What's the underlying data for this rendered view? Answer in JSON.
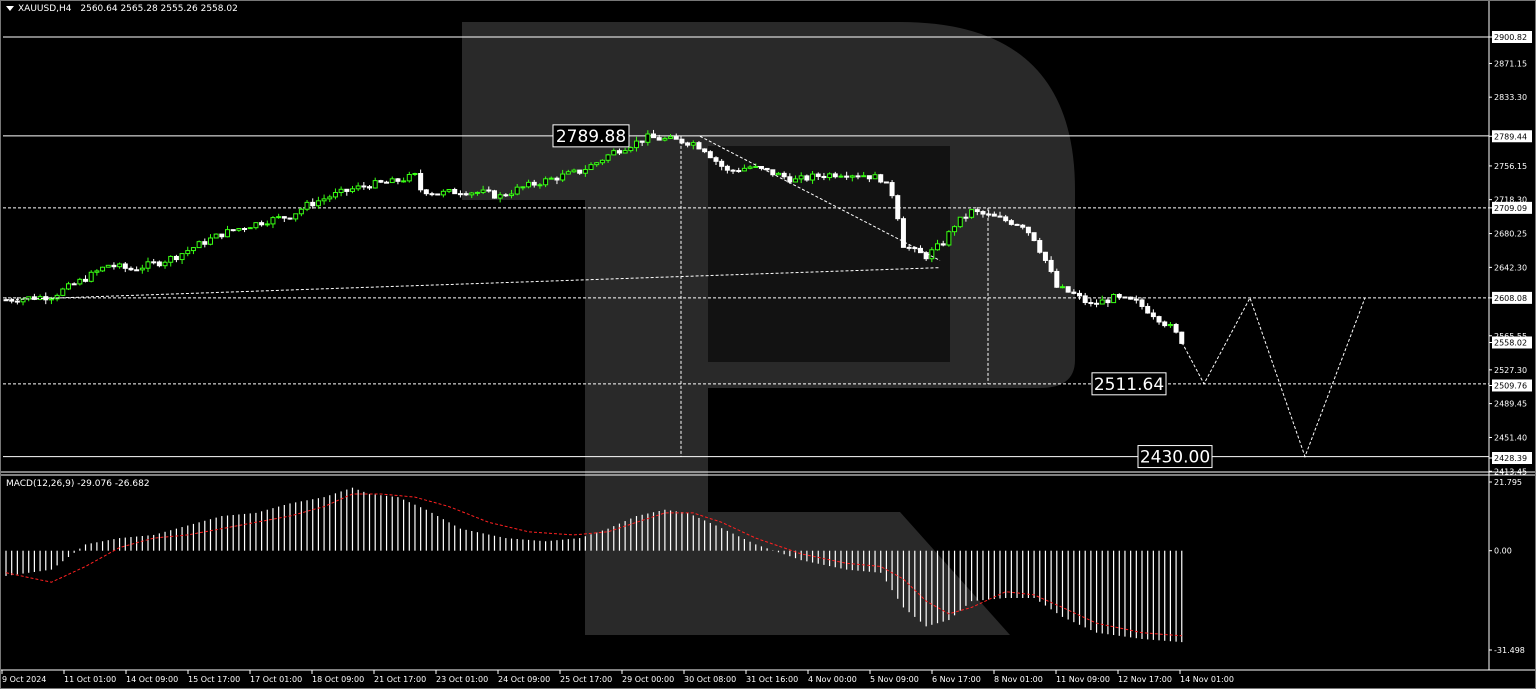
{
  "header": {
    "symbol": "XAUUSD,H4",
    "ohlc": "2560.64 2565.28 2555.26 2558.02"
  },
  "macd_header": "MACD(12,26,9) -29.076 -26.682",
  "colors": {
    "background": "#000000",
    "bull_candle": "#39ff14",
    "bear_candle": "#ffffff",
    "macd_hist": "#ffffff",
    "macd_signal": "#ff2020",
    "watermark": "#4a4a4a",
    "level_line": "#ffffff"
  },
  "chart_data": {
    "type": "candlestick",
    "price_axis": {
      "range": [
        2413.45,
        2920.0
      ],
      "ticks": [
        "2900.82",
        "2871.15",
        "2833.30",
        "2789.44",
        "2756.15",
        "2718.30",
        "2709.09",
        "2680.25",
        "2642.30",
        "2608.08",
        "2565.55",
        "2558.02",
        "2527.30",
        "2509.76",
        "2489.45",
        "2451.40",
        "2428.39",
        "2413.45"
      ],
      "current_price": 2558.02
    },
    "levels": [
      {
        "price": 2900.82,
        "style": "solid"
      },
      {
        "price": 2789.88,
        "style": "solid",
        "label": "2789.88"
      },
      {
        "price": 2709.09,
        "style": "dashed"
      },
      {
        "price": 2608.08,
        "style": "dashed"
      },
      {
        "price": 2511.64,
        "style": "dashed",
        "label": "2511.64"
      },
      {
        "price": 2430.0,
        "style": "solid",
        "label": "2430.00"
      }
    ],
    "time_labels": [
      "9 Oct 2024",
      "11 Oct 01:00",
      "14 Oct 09:00",
      "15 Oct 17:00",
      "17 Oct 01:00",
      "18 Oct 09:00",
      "21 Oct 17:00",
      "23 Oct 01:00",
      "24 Oct 09:00",
      "25 Oct 17:00",
      "29 Oct 00:00",
      "30 Oct 08:00",
      "31 Oct 16:00",
      "4 Nov 00:00",
      "5 Nov 09:00",
      "6 Nov 17:00",
      "8 Nov 01:00",
      "11 Nov 09:00",
      "12 Nov 17:00",
      "14 Nov 01:00"
    ],
    "price_path": [
      [
        0,
        2606
      ],
      [
        8,
        2610
      ],
      [
        14,
        2630
      ],
      [
        18,
        2645
      ],
      [
        22,
        2640
      ],
      [
        27,
        2648
      ],
      [
        30,
        2655
      ],
      [
        34,
        2668
      ],
      [
        38,
        2680
      ],
      [
        42,
        2688
      ],
      [
        46,
        2695
      ],
      [
        50,
        2700
      ],
      [
        53,
        2712
      ],
      [
        57,
        2722
      ],
      [
        61,
        2730
      ],
      [
        64,
        2735
      ],
      [
        68,
        2738
      ],
      [
        72,
        2745
      ],
      [
        73,
        2730
      ],
      [
        76,
        2725
      ],
      [
        80,
        2728
      ],
      [
        84,
        2726
      ],
      [
        87,
        2722
      ],
      [
        90,
        2730
      ],
      [
        94,
        2738
      ],
      [
        98,
        2745
      ],
      [
        101,
        2750
      ],
      [
        104,
        2760
      ],
      [
        107,
        2772
      ],
      [
        110,
        2780
      ],
      [
        113,
        2788
      ],
      [
        116,
        2786
      ],
      [
        119,
        2784
      ],
      [
        121,
        2782
      ],
      [
        123,
        2775
      ],
      [
        125,
        2762
      ],
      [
        127,
        2750
      ],
      [
        131,
        2755
      ],
      [
        135,
        2748
      ],
      [
        139,
        2740
      ],
      [
        143,
        2745
      ],
      [
        147,
        2748
      ],
      [
        151,
        2746
      ],
      [
        154,
        2742
      ],
      [
        156,
        2725
      ],
      [
        157,
        2700
      ],
      [
        158,
        2668
      ],
      [
        160,
        2660
      ],
      [
        162,
        2655
      ],
      [
        165,
        2670
      ],
      [
        167,
        2690
      ],
      [
        170,
        2705
      ],
      [
        173,
        2700
      ],
      [
        176,
        2695
      ],
      [
        179,
        2690
      ],
      [
        181,
        2675
      ],
      [
        183,
        2650
      ],
      [
        185,
        2620
      ],
      [
        188,
        2612
      ],
      [
        191,
        2600
      ],
      [
        195,
        2608
      ],
      [
        199,
        2603
      ],
      [
        202,
        2590
      ],
      [
        205,
        2575
      ],
      [
        207,
        2560
      ]
    ],
    "candle_count": 208,
    "macd": {
      "axis_ticks": [
        "21.795",
        "0.00",
        "-31.498"
      ],
      "axis_range": [
        -31.498,
        21.795
      ],
      "histogram_path": [
        [
          0,
          -8
        ],
        [
          8,
          -6
        ],
        [
          14,
          2
        ],
        [
          20,
          4
        ],
        [
          26,
          5
        ],
        [
          32,
          8
        ],
        [
          38,
          11
        ],
        [
          44,
          12
        ],
        [
          50,
          15
        ],
        [
          56,
          17
        ],
        [
          61,
          20
        ],
        [
          64,
          18
        ],
        [
          69,
          17
        ],
        [
          74,
          13
        ],
        [
          80,
          7
        ],
        [
          88,
          4
        ],
        [
          95,
          3
        ],
        [
          101,
          4
        ],
        [
          106,
          7
        ],
        [
          111,
          11
        ],
        [
          116,
          13
        ],
        [
          120,
          12
        ],
        [
          125,
          8
        ],
        [
          132,
          2
        ],
        [
          140,
          -3
        ],
        [
          148,
          -6
        ],
        [
          154,
          -7
        ],
        [
          158,
          -18
        ],
        [
          162,
          -24
        ],
        [
          166,
          -22
        ],
        [
          170,
          -16
        ],
        [
          176,
          -15
        ],
        [
          181,
          -15
        ],
        [
          186,
          -21
        ],
        [
          192,
          -26
        ],
        [
          200,
          -28
        ],
        [
          207,
          -29
        ]
      ],
      "signal_path": [
        [
          0,
          -7
        ],
        [
          8,
          -10
        ],
        [
          14,
          -5
        ],
        [
          20,
          1
        ],
        [
          26,
          4
        ],
        [
          32,
          5
        ],
        [
          38,
          7
        ],
        [
          44,
          9
        ],
        [
          50,
          11
        ],
        [
          56,
          14
        ],
        [
          61,
          18
        ],
        [
          66,
          18
        ],
        [
          72,
          17
        ],
        [
          78,
          14
        ],
        [
          85,
          9
        ],
        [
          92,
          6
        ],
        [
          100,
          5
        ],
        [
          106,
          6
        ],
        [
          111,
          9
        ],
        [
          116,
          12
        ],
        [
          121,
          12
        ],
        [
          126,
          9
        ],
        [
          132,
          4
        ],
        [
          140,
          -1
        ],
        [
          148,
          -4
        ],
        [
          154,
          -5
        ],
        [
          158,
          -9
        ],
        [
          162,
          -16
        ],
        [
          166,
          -20
        ],
        [
          170,
          -18
        ],
        [
          176,
          -13
        ],
        [
          181,
          -14
        ],
        [
          186,
          -18
        ],
        [
          192,
          -23
        ],
        [
          200,
          -26
        ],
        [
          207,
          -27
        ]
      ]
    },
    "forecast_path": [
      [
        2511.64,
        1204
      ],
      [
        2608.08,
        1250
      ],
      [
        2430.0,
        1305
      ],
      [
        2608.08,
        1365
      ]
    ]
  }
}
